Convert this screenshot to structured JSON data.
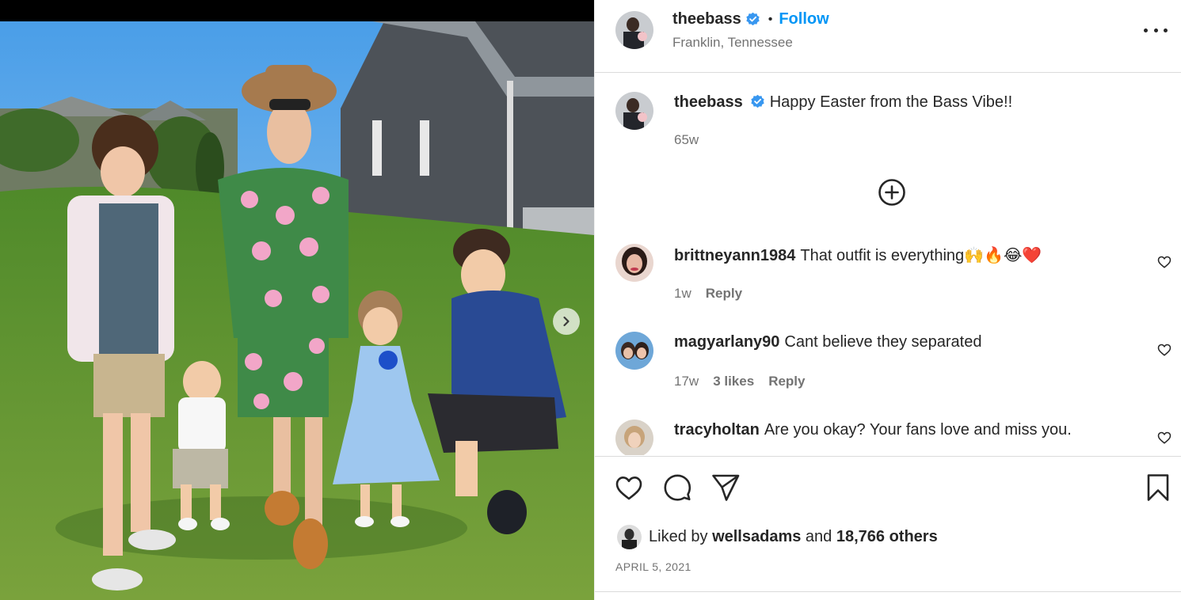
{
  "post": {
    "username": "theebass",
    "follow_label": "Follow",
    "separator": "•",
    "location": "Franklin, Tennessee",
    "caption": "Happy Easter from the Bass Vibe!!",
    "caption_age": "65w"
  },
  "comments": [
    {
      "username": "brittneyann1984",
      "text": "That outfit is everything🙌🔥😂❤️",
      "age": "1w",
      "likes": "",
      "reply_label": "Reply"
    },
    {
      "username": "magyarlany90",
      "text": "Cant believe they separated",
      "age": "17w",
      "likes": "3 likes",
      "reply_label": "Reply"
    },
    {
      "username": "tracyholtan",
      "text": "Are you okay? Your fans love and miss you.",
      "age": "",
      "likes": "",
      "reply_label": ""
    }
  ],
  "likes": {
    "prefix": "Liked by",
    "user": "wellsadams",
    "joiner": "and",
    "others": "18,766 others"
  },
  "date": "APRIL 5, 2021",
  "icons": [
    "verified-badge-icon",
    "more-options-icon",
    "add-circle-icon",
    "heart-icon",
    "comment-icon",
    "share-icon",
    "bookmark-icon",
    "chevron-right-icon"
  ],
  "colors": {
    "accent": "#0095f6",
    "verified": "#3897f0",
    "text": "#262626",
    "muted": "#737373",
    "divider": "#dbdbdb"
  }
}
